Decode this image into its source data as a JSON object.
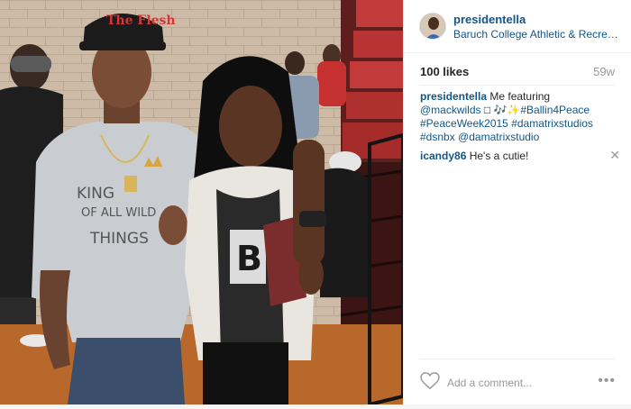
{
  "post": {
    "username": "presidentella",
    "location": "Baruch College Athletic & Recreation Center",
    "likes": "100 likes",
    "age": "59w",
    "shirt_text": "KING OF ALL WILD THINGS",
    "cap_text": "The Flesh"
  },
  "caption": {
    "username": "presidentella",
    "text_1": "Me featuring",
    "mention_1": "@mackwilds",
    "text_2": "□ 🎶✨",
    "hashtag_1": "#Ballin4Peace",
    "hashtag_2": "#PeaceWeek2015",
    "hashtag_3": "#damatrixstudios",
    "hashtag_4": "#dsnbx",
    "mention_2": "@damatrixstudio"
  },
  "comments": [
    {
      "username": "icandy86",
      "text": "He's a cutie!",
      "close": "✕"
    }
  ],
  "footer": {
    "add_comment": "Add a comment...",
    "more": "•••"
  },
  "icons": {
    "heart": "heart-icon",
    "more": "more-options-icon",
    "close": "close-icon"
  },
  "colors": {
    "link": "#125688",
    "muted": "#999999",
    "text": "#262626",
    "border": "#efefef"
  }
}
